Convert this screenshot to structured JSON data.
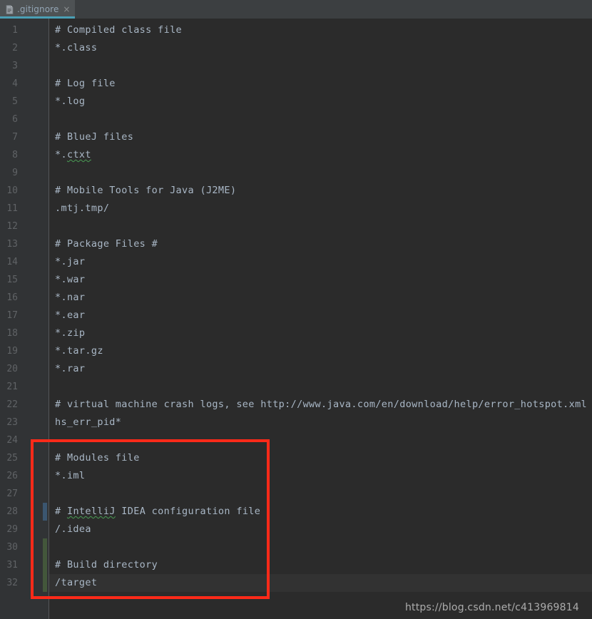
{
  "window": {
    "background_color": "#2B2B2B",
    "tabbar_color": "#3C3F41"
  },
  "tabbar": {
    "tabs": [
      {
        "label": ".gitignore",
        "icon": "file-icon",
        "close_glyph": "×",
        "active": true,
        "accent_color": "#4A9FB5"
      }
    ]
  },
  "editor": {
    "file_name": ".gitignore",
    "first_line": 1,
    "total_lines": 32,
    "caret_line": 32,
    "line_height_px": 25,
    "colors": {
      "text": "#A9B7C6",
      "line_number": "#606366",
      "gutter_bg": "#313335",
      "editor_bg": "#2B2B2B",
      "caret_line_bg": "#323232",
      "typo_underline": "#499C54",
      "vcs_modified": "#3B5670",
      "vcs_added": "#43573B"
    },
    "lines": [
      {
        "n": "1",
        "text": "# Compiled class file"
      },
      {
        "n": "2",
        "text": "*.class"
      },
      {
        "n": "3",
        "text": ""
      },
      {
        "n": "4",
        "text": "# Log file"
      },
      {
        "n": "5",
        "text": "*.log"
      },
      {
        "n": "6",
        "text": ""
      },
      {
        "n": "7",
        "text": "# BlueJ files"
      },
      {
        "n": "8",
        "text": "*.ctxt",
        "typo": "ctxt"
      },
      {
        "n": "9",
        "text": ""
      },
      {
        "n": "10",
        "text": "# Mobile Tools for Java (J2ME)"
      },
      {
        "n": "11",
        "text": ".mtj.tmp/"
      },
      {
        "n": "12",
        "text": ""
      },
      {
        "n": "13",
        "text": "# Package Files #"
      },
      {
        "n": "14",
        "text": "*.jar"
      },
      {
        "n": "15",
        "text": "*.war"
      },
      {
        "n": "16",
        "text": "*.nar"
      },
      {
        "n": "17",
        "text": "*.ear"
      },
      {
        "n": "18",
        "text": "*.zip"
      },
      {
        "n": "19",
        "text": "*.tar.gz"
      },
      {
        "n": "20",
        "text": "*.rar"
      },
      {
        "n": "21",
        "text": ""
      },
      {
        "n": "22",
        "text": "# virtual machine crash logs, see http://www.java.com/en/download/help/error_hotspot.xml"
      },
      {
        "n": "23",
        "text": "hs_err_pid*"
      },
      {
        "n": "24",
        "text": ""
      },
      {
        "n": "25",
        "text": "# Modules file"
      },
      {
        "n": "26",
        "text": "*.iml"
      },
      {
        "n": "27",
        "text": ""
      },
      {
        "n": "28",
        "text": "# IntelliJ IDEA configuration file",
        "typo": "IntelliJ"
      },
      {
        "n": "29",
        "text": "/.idea"
      },
      {
        "n": "30",
        "text": ""
      },
      {
        "n": "31",
        "text": "# Build directory"
      },
      {
        "n": "32",
        "text": "/target"
      }
    ],
    "vcs_markers": [
      {
        "type": "modified",
        "from_line": 28,
        "to_line": 28
      },
      {
        "type": "added",
        "from_line": 30,
        "to_line": 32
      }
    ]
  },
  "annotation": {
    "type": "rectangle-highlight",
    "color": "#FF2A19",
    "covers_lines": "25-32"
  },
  "watermark": {
    "text": "https://blog.csdn.net/c413969814"
  }
}
